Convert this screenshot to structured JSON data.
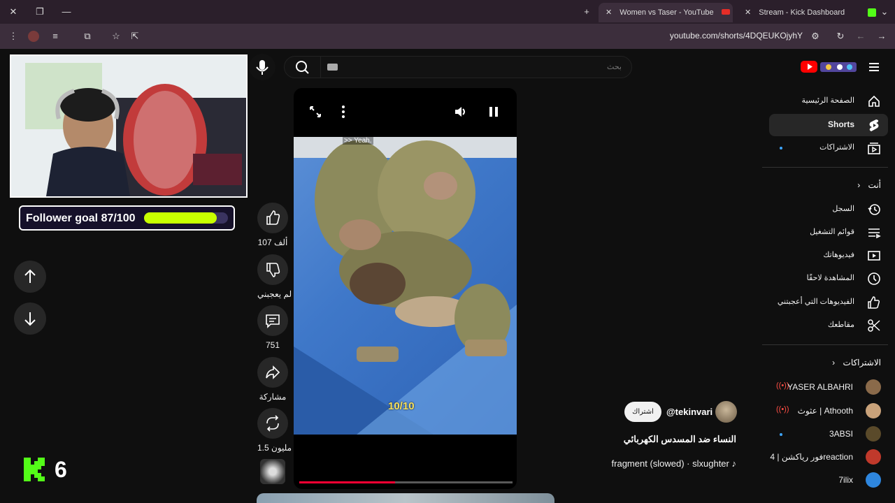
{
  "browser": {
    "tabs": [
      {
        "title": "Women vs Taser - YouTube",
        "active": true
      },
      {
        "title": "Stream - Kick Dashboard",
        "active": false
      }
    ],
    "url": "youtube.com/shorts/4DQEUKOjyhY"
  },
  "overlay": {
    "follower_goal": "Follower goal 87/100",
    "follower_goal_progress": 0.87,
    "kick_count": "6"
  },
  "search": {
    "placeholder": "بحث"
  },
  "video": {
    "caption": ">> Yeah.",
    "counter": "10/10",
    "progress": 0.45
  },
  "actions": {
    "likes": "107 ألف",
    "dislike": "لم يعجبني",
    "comments": "751",
    "share": "مشاركة",
    "remix": "1.5 مليون"
  },
  "channel": {
    "handle": "@tekinvari",
    "subscribe": "اشتراك",
    "title": "النساء ضد المسدس الكهربائي",
    "sound": "fragment (slowed) · slxughter"
  },
  "sidebar": {
    "main": [
      {
        "label": "الصفحة الرئيسية",
        "icon": "home-icon"
      },
      {
        "label": "Shorts",
        "icon": "shorts-icon"
      },
      {
        "label": "الاشتراكات",
        "icon": "subscriptions-icon"
      }
    ],
    "you_header": "أنت",
    "you": [
      {
        "label": "السجل",
        "icon": "history-icon"
      },
      {
        "label": "قوائم التشغيل",
        "icon": "playlists-icon"
      },
      {
        "label": "فيديوهاتك",
        "icon": "your-videos-icon"
      },
      {
        "label": "المشاهدة لاحقًا",
        "icon": "watch-later-icon"
      },
      {
        "label": "الفيديوهات التي أعجبتني",
        "icon": "liked-videos-icon"
      },
      {
        "label": "مقاطعك",
        "icon": "clips-icon"
      }
    ],
    "subs_header": "الاشتراكات",
    "subs": [
      {
        "label": "YASER ALBAHRI",
        "live": true,
        "color": "#8a6a4a"
      },
      {
        "label": "عثوث | Athooth",
        "live": true,
        "color": "#c9a27a"
      },
      {
        "label": "3ABSI",
        "live": false,
        "color": "#5a4a2a"
      },
      {
        "label": "فور رياكشن | 4reaction",
        "live": false,
        "color": "#c0392b"
      },
      {
        "label": "7ilix",
        "live": false,
        "color": "#2e86de"
      }
    ]
  }
}
